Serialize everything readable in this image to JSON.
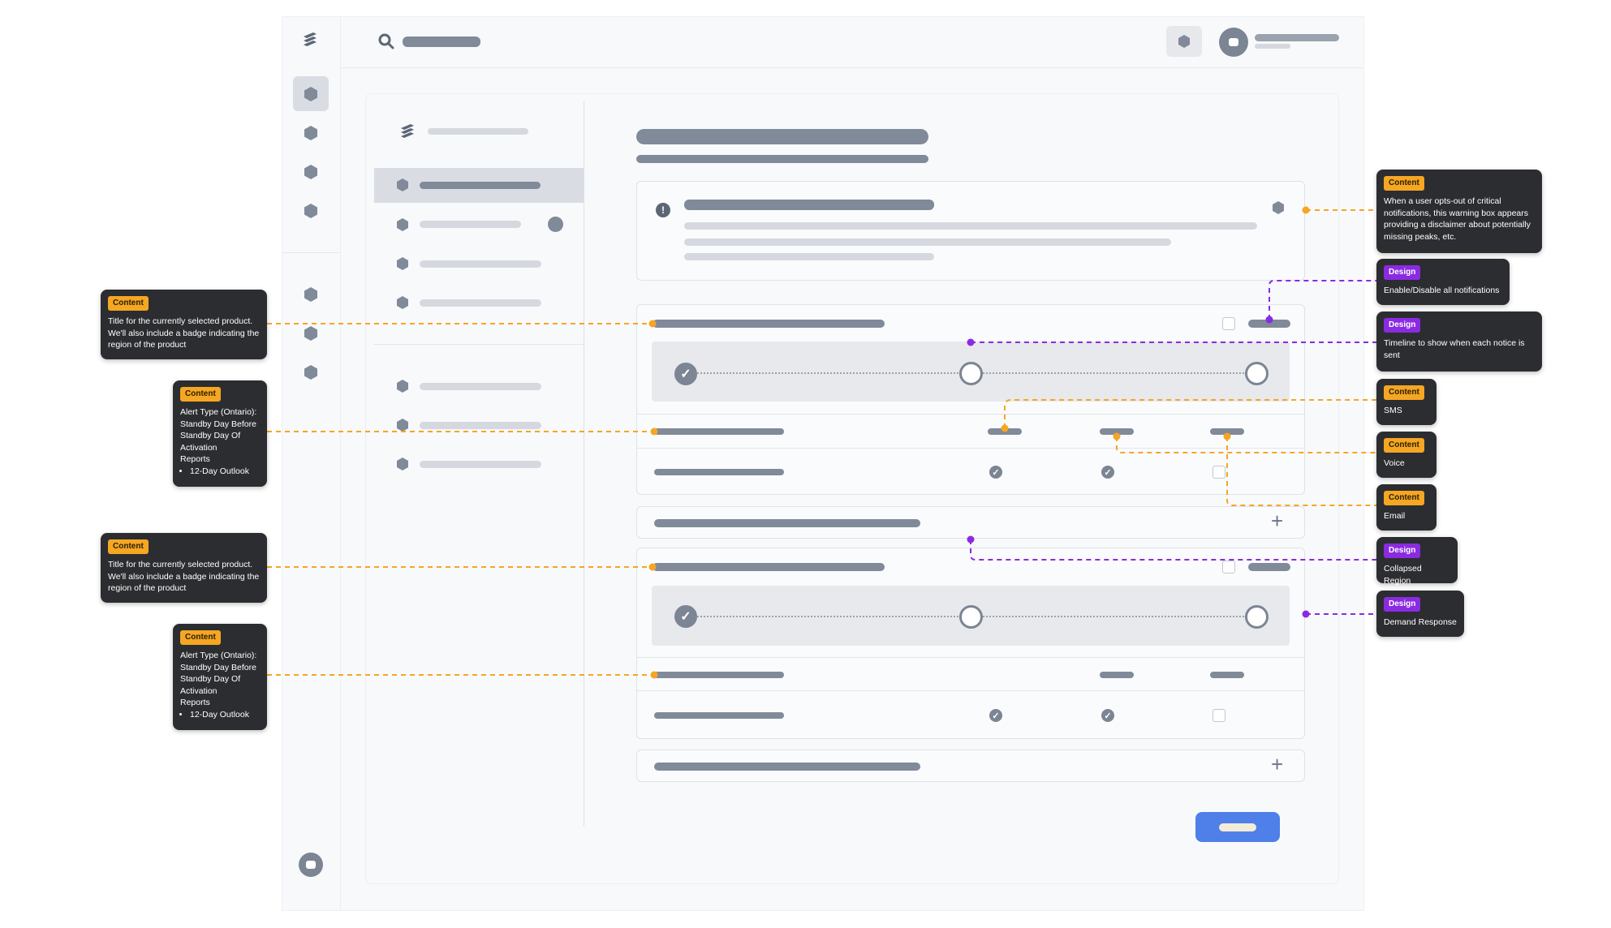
{
  "annotations": {
    "left_title_1": {
      "tag": "Content",
      "text": "Title for the currently selected product. We'll also include a badge indicating the region of the product"
    },
    "left_alert_1": {
      "tag": "Content",
      "lines": [
        "Alert Type (Ontario):",
        "Standby Day Before",
        "Standby Day Of",
        "Activation",
        "Reports"
      ],
      "bullet": "12-Day Outlook"
    },
    "left_title_2": {
      "tag": "Content",
      "text": "Title for the currently selected product. We'll also include a badge indicating the region of the product"
    },
    "left_alert_2": {
      "tag": "Content",
      "lines": [
        "Alert Type (Ontario):",
        "Standby Day Before",
        "Standby Day Of",
        "Activation",
        "Reports"
      ],
      "bullet": "12-Day Outlook"
    },
    "right_warning": {
      "tag": "Content",
      "text": "When a user opts-out of critical notifications, this warning box appears providing a disclaimer about potentially missing peaks, etc."
    },
    "right_enable": {
      "tag": "Design",
      "text": "Enable/Disable all notifications"
    },
    "right_timeline": {
      "tag": "Design",
      "text": "Timeline to show when each notice is sent"
    },
    "right_sms": {
      "tag": "Content",
      "text": "SMS"
    },
    "right_voice": {
      "tag": "Content",
      "text": "Voice"
    },
    "right_email": {
      "tag": "Content",
      "text": "Email"
    },
    "right_collapsed": {
      "tag": "Design",
      "text": "Collapsed Region"
    },
    "right_demand": {
      "tag": "Design",
      "text": "Demand Response"
    }
  },
  "icons": {
    "logo": "layers-logo-icon",
    "search": "search-icon",
    "alert": "alert-icon",
    "check": "check-icon",
    "plus": "plus-icon",
    "avatar": "avatar-icon"
  },
  "glyphs": {
    "check": "✓",
    "alert": "!",
    "plus": "+"
  },
  "colors": {
    "content_tag": "#f5a623",
    "design_tag": "#8a2be2",
    "primary_button": "#4f7fe8",
    "skeleton": "#808a99",
    "skeleton_light": "#d5d9df"
  }
}
